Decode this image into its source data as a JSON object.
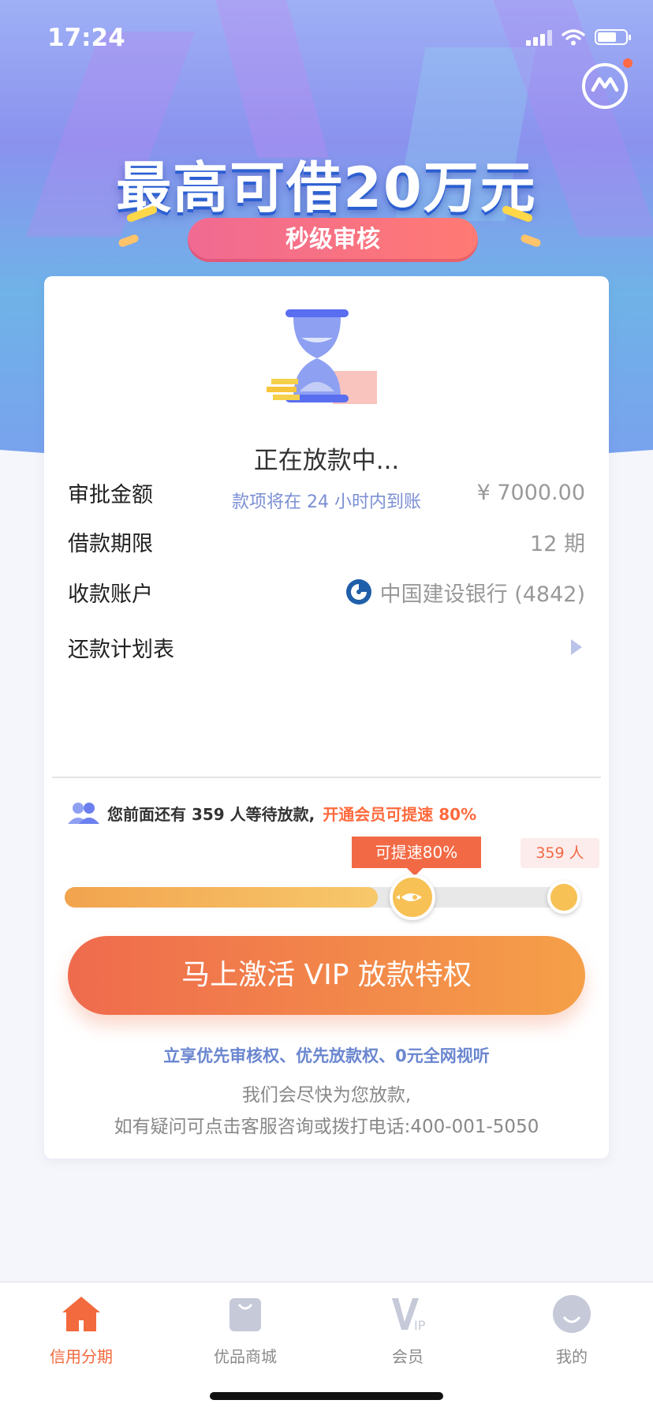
{
  "status_bar": {
    "time": "17:24"
  },
  "banner": {
    "title": "最高可借20万元",
    "pill": "秒级审核"
  },
  "loan_status": {
    "title": "正在放款中...",
    "subtitle": "款项将在 24 小时内到账"
  },
  "details": [
    {
      "label": "审批金额",
      "value": "¥ 7000.00"
    },
    {
      "label": "借款期限",
      "value": "12 期"
    },
    {
      "label": "收款账户",
      "value": "中国建设银行 (4842)",
      "icon": "ccb-bank-icon"
    },
    {
      "label": "还款计划表",
      "value": "",
      "icon": "arrow-right-icon"
    }
  ],
  "queue": {
    "text": "您前面还有 359 人等待放款,",
    "highlight": "开通会员可提速 80%",
    "speed_tip": "可提速80%",
    "count_tip": "359 人",
    "progress_fraction": 0.62
  },
  "vip_button": "马上激活 VIP 放款特权",
  "benefits": "立享优先审核权、优先放款权、0元全网视听",
  "notes": [
    "我们会尽快为您放款,",
    "如有疑问可点击客服咨询或拨打电话:400-001-5050"
  ],
  "tabs": [
    {
      "label": "信用分期",
      "icon": "home-icon",
      "active": true
    },
    {
      "label": "优品商城",
      "icon": "shopping-bag-icon",
      "active": false
    },
    {
      "label": "会员",
      "icon": "vip-icon",
      "active": false
    },
    {
      "label": "我的",
      "icon": "profile-icon",
      "active": false
    }
  ],
  "colors": {
    "accent": "#f26a3d",
    "link_blue": "#6a86cf",
    "button_gradient_start": "#ef6a4d",
    "button_gradient_end": "#f5a048"
  }
}
